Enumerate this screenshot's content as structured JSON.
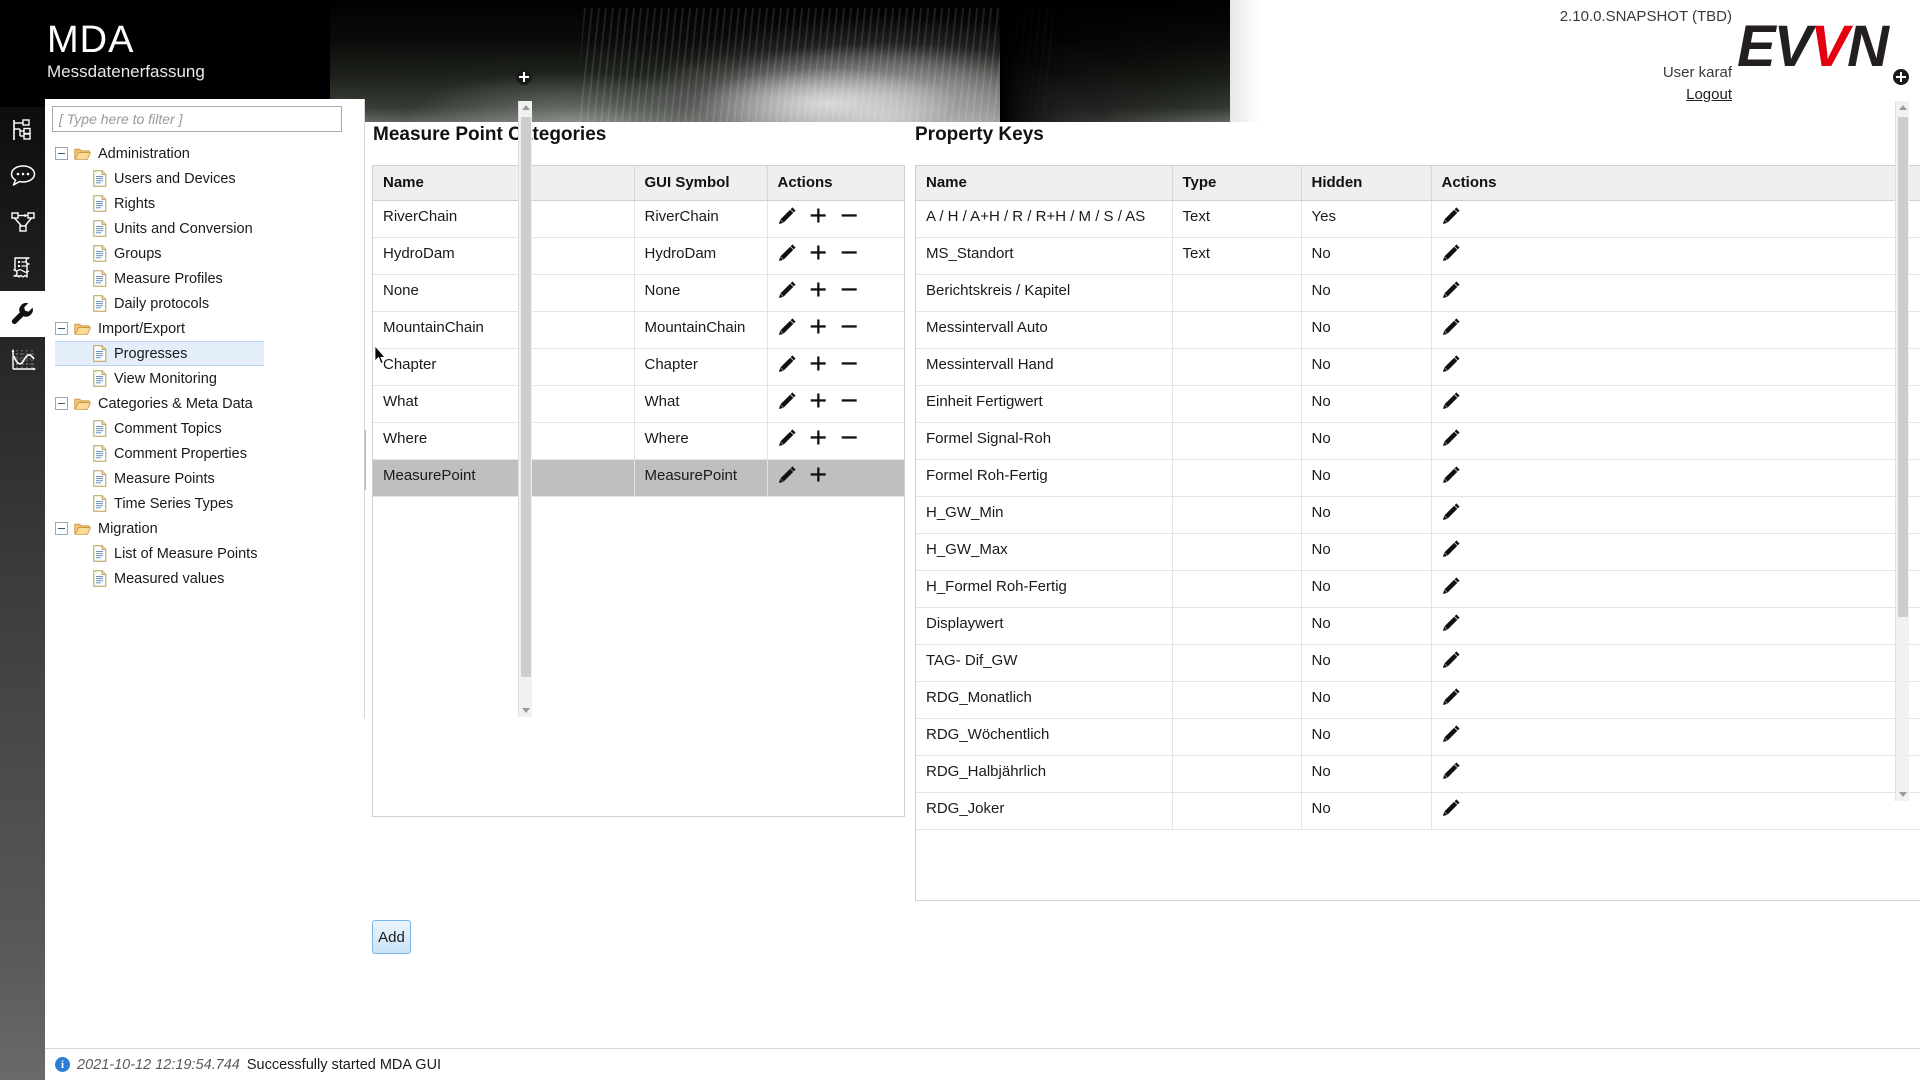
{
  "header": {
    "app_title": "MDA",
    "app_subtitle": "Messdatenerfassung",
    "version": "2.10.0.SNAPSHOT (TBD)",
    "user_label": "User karaf",
    "logout_label": "Logout",
    "logo": {
      "part1": "EV",
      "part2": "V",
      "part3": "N",
      "accent_color": "#e3000f",
      "dark_color": "#231f20"
    }
  },
  "rail": {
    "items": [
      {
        "name": "hierarchy-icon"
      },
      {
        "name": "comment-icon"
      },
      {
        "name": "flow-diagram-icon"
      },
      {
        "name": "protocol-scroll-icon"
      },
      {
        "name": "wrench-icon",
        "active": true
      },
      {
        "name": "chart-icon"
      }
    ]
  },
  "sidebar": {
    "filter_placeholder": "[ Type here to filter ]",
    "filter_value": "",
    "tree": [
      {
        "label": "Administration",
        "type": "folder",
        "expanded": true
      },
      {
        "label": "Users and Devices",
        "type": "doc"
      },
      {
        "label": "Rights",
        "type": "doc"
      },
      {
        "label": "Units and Conversion",
        "type": "doc"
      },
      {
        "label": "Groups",
        "type": "doc"
      },
      {
        "label": "Measure Profiles",
        "type": "doc"
      },
      {
        "label": "Daily protocols",
        "type": "doc"
      },
      {
        "label": "Import/Export",
        "type": "folder",
        "expanded": true
      },
      {
        "label": "Progresses",
        "type": "doc",
        "selected": true
      },
      {
        "label": "View Monitoring",
        "type": "doc"
      },
      {
        "label": "Categories & Meta Data",
        "type": "folder",
        "expanded": true
      },
      {
        "label": "Comment Topics",
        "type": "doc"
      },
      {
        "label": "Comment Properties",
        "type": "doc"
      },
      {
        "label": "Measure Points",
        "type": "doc"
      },
      {
        "label": "Time Series Types",
        "type": "doc"
      },
      {
        "label": "Migration",
        "type": "folder",
        "expanded": true
      },
      {
        "label": "List of Measure Points",
        "type": "doc"
      },
      {
        "label": "Measured values",
        "type": "doc"
      }
    ]
  },
  "measure_point_categories": {
    "title": "Measure Point Categories",
    "columns": [
      "Name",
      "GUI Symbol",
      "Actions"
    ],
    "rows": [
      {
        "name": "RiverChain",
        "gui_symbol": "RiverChain",
        "actions": [
          "edit",
          "add",
          "remove"
        ],
        "selected": false
      },
      {
        "name": "HydroDam",
        "gui_symbol": "HydroDam",
        "actions": [
          "edit",
          "add",
          "remove"
        ],
        "selected": false
      },
      {
        "name": "None",
        "gui_symbol": "None",
        "actions": [
          "edit",
          "add",
          "remove"
        ],
        "selected": false
      },
      {
        "name": "MountainChain",
        "gui_symbol": "MountainChain",
        "actions": [
          "edit",
          "add",
          "remove"
        ],
        "selected": false
      },
      {
        "name": "Chapter",
        "gui_symbol": "Chapter",
        "actions": [
          "edit",
          "add",
          "remove"
        ],
        "selected": false
      },
      {
        "name": "What",
        "gui_symbol": "What",
        "actions": [
          "edit",
          "add",
          "remove"
        ],
        "selected": false
      },
      {
        "name": "Where",
        "gui_symbol": "Where",
        "actions": [
          "edit",
          "add",
          "remove"
        ],
        "selected": false
      },
      {
        "name": "MeasurePoint",
        "gui_symbol": "MeasurePoint",
        "actions": [
          "edit",
          "add"
        ],
        "selected": true
      }
    ],
    "add_button_label": "Add"
  },
  "property_keys": {
    "title": "Property Keys",
    "columns": [
      "Name",
      "Type",
      "Hidden",
      "Actions"
    ],
    "rows": [
      {
        "name": "A / H / A+H / R / R+H / M / S / AS",
        "type": "Text",
        "hidden": "Yes",
        "actions": [
          "edit"
        ]
      },
      {
        "name": "MS_Standort",
        "type": "Text",
        "hidden": "No",
        "actions": [
          "edit"
        ]
      },
      {
        "name": "Berichtskreis / Kapitel",
        "type": "",
        "hidden": "No",
        "actions": [
          "edit"
        ]
      },
      {
        "name": "Messintervall Auto",
        "type": "",
        "hidden": "No",
        "actions": [
          "edit"
        ]
      },
      {
        "name": "Messintervall Hand",
        "type": "",
        "hidden": "No",
        "actions": [
          "edit"
        ]
      },
      {
        "name": "Einheit Fertigwert",
        "type": "",
        "hidden": "No",
        "actions": [
          "edit"
        ]
      },
      {
        "name": "Formel Signal-Roh",
        "type": "",
        "hidden": "No",
        "actions": [
          "edit"
        ]
      },
      {
        "name": "Formel Roh-Fertig",
        "type": "",
        "hidden": "No",
        "actions": [
          "edit"
        ]
      },
      {
        "name": "H_GW_Min",
        "type": "",
        "hidden": "No",
        "actions": [
          "edit"
        ]
      },
      {
        "name": "H_GW_Max",
        "type": "",
        "hidden": "No",
        "actions": [
          "edit"
        ]
      },
      {
        "name": "H_Formel Roh-Fertig",
        "type": "",
        "hidden": "No",
        "actions": [
          "edit"
        ]
      },
      {
        "name": "Displaywert",
        "type": "",
        "hidden": "No",
        "actions": [
          "edit"
        ]
      },
      {
        "name": "TAG- Dif_GW",
        "type": "",
        "hidden": "No",
        "actions": [
          "edit"
        ]
      },
      {
        "name": "RDG_Monatlich",
        "type": "",
        "hidden": "No",
        "actions": [
          "edit"
        ]
      },
      {
        "name": "RDG_Wöchentlich",
        "type": "",
        "hidden": "No",
        "actions": [
          "edit"
        ]
      },
      {
        "name": "RDG_Halbjährlich",
        "type": "",
        "hidden": "No",
        "actions": [
          "edit"
        ]
      },
      {
        "name": "RDG_Joker",
        "type": "",
        "hidden": "No",
        "actions": [
          "edit"
        ]
      }
    ]
  },
  "status": {
    "badge": "i",
    "timestamp": "2021-10-12 12:19:54.744",
    "message": "Successfully started MDA GUI"
  }
}
